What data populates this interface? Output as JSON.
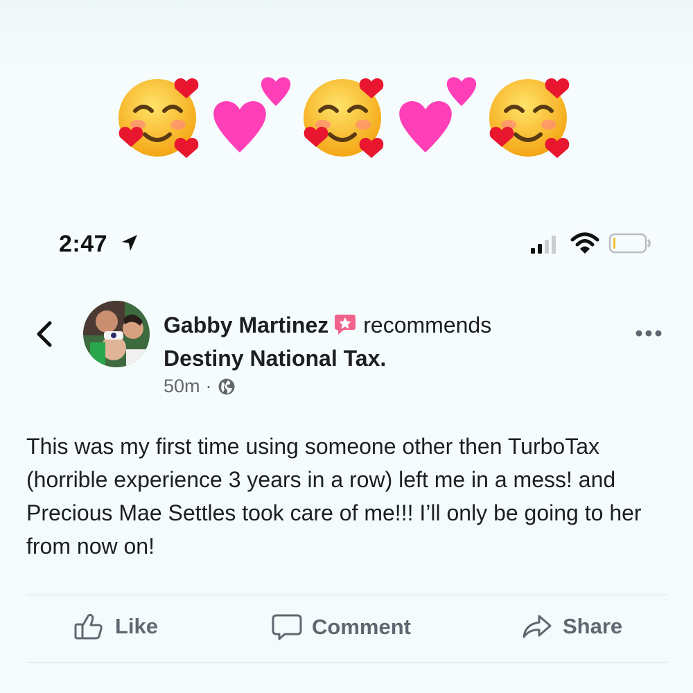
{
  "status_bar": {
    "time": "2:47",
    "icons": [
      "location-arrow-icon",
      "signal-icon",
      "wifi-icon",
      "battery-icon"
    ]
  },
  "decoration": {
    "emojis": [
      "smiling-face-with-hearts",
      "two-hearts",
      "smiling-face-with-hearts",
      "two-hearts",
      "smiling-face-with-hearts"
    ]
  },
  "post": {
    "author": "Gabby Martinez",
    "action": "recommends",
    "page": "Destiny National Tax.",
    "time": "50m",
    "separator": "·",
    "audience_icon": "globe-icon",
    "body": "This was my first time using someone other then TurboTax (horrible experience 3 years in a row) left me in a mess! and Precious Mae Settles took care of me!!! I’ll only be going to her from now on!"
  },
  "actions": {
    "like": "Like",
    "comment": "Comment",
    "share": "Share"
  },
  "colors": {
    "background": "#f4fbfc",
    "text": "#1c1e21",
    "secondary": "#65676b",
    "action": "#606770",
    "recommend_badge": "#f0648c",
    "heart_pink": "#ff3fb8"
  }
}
